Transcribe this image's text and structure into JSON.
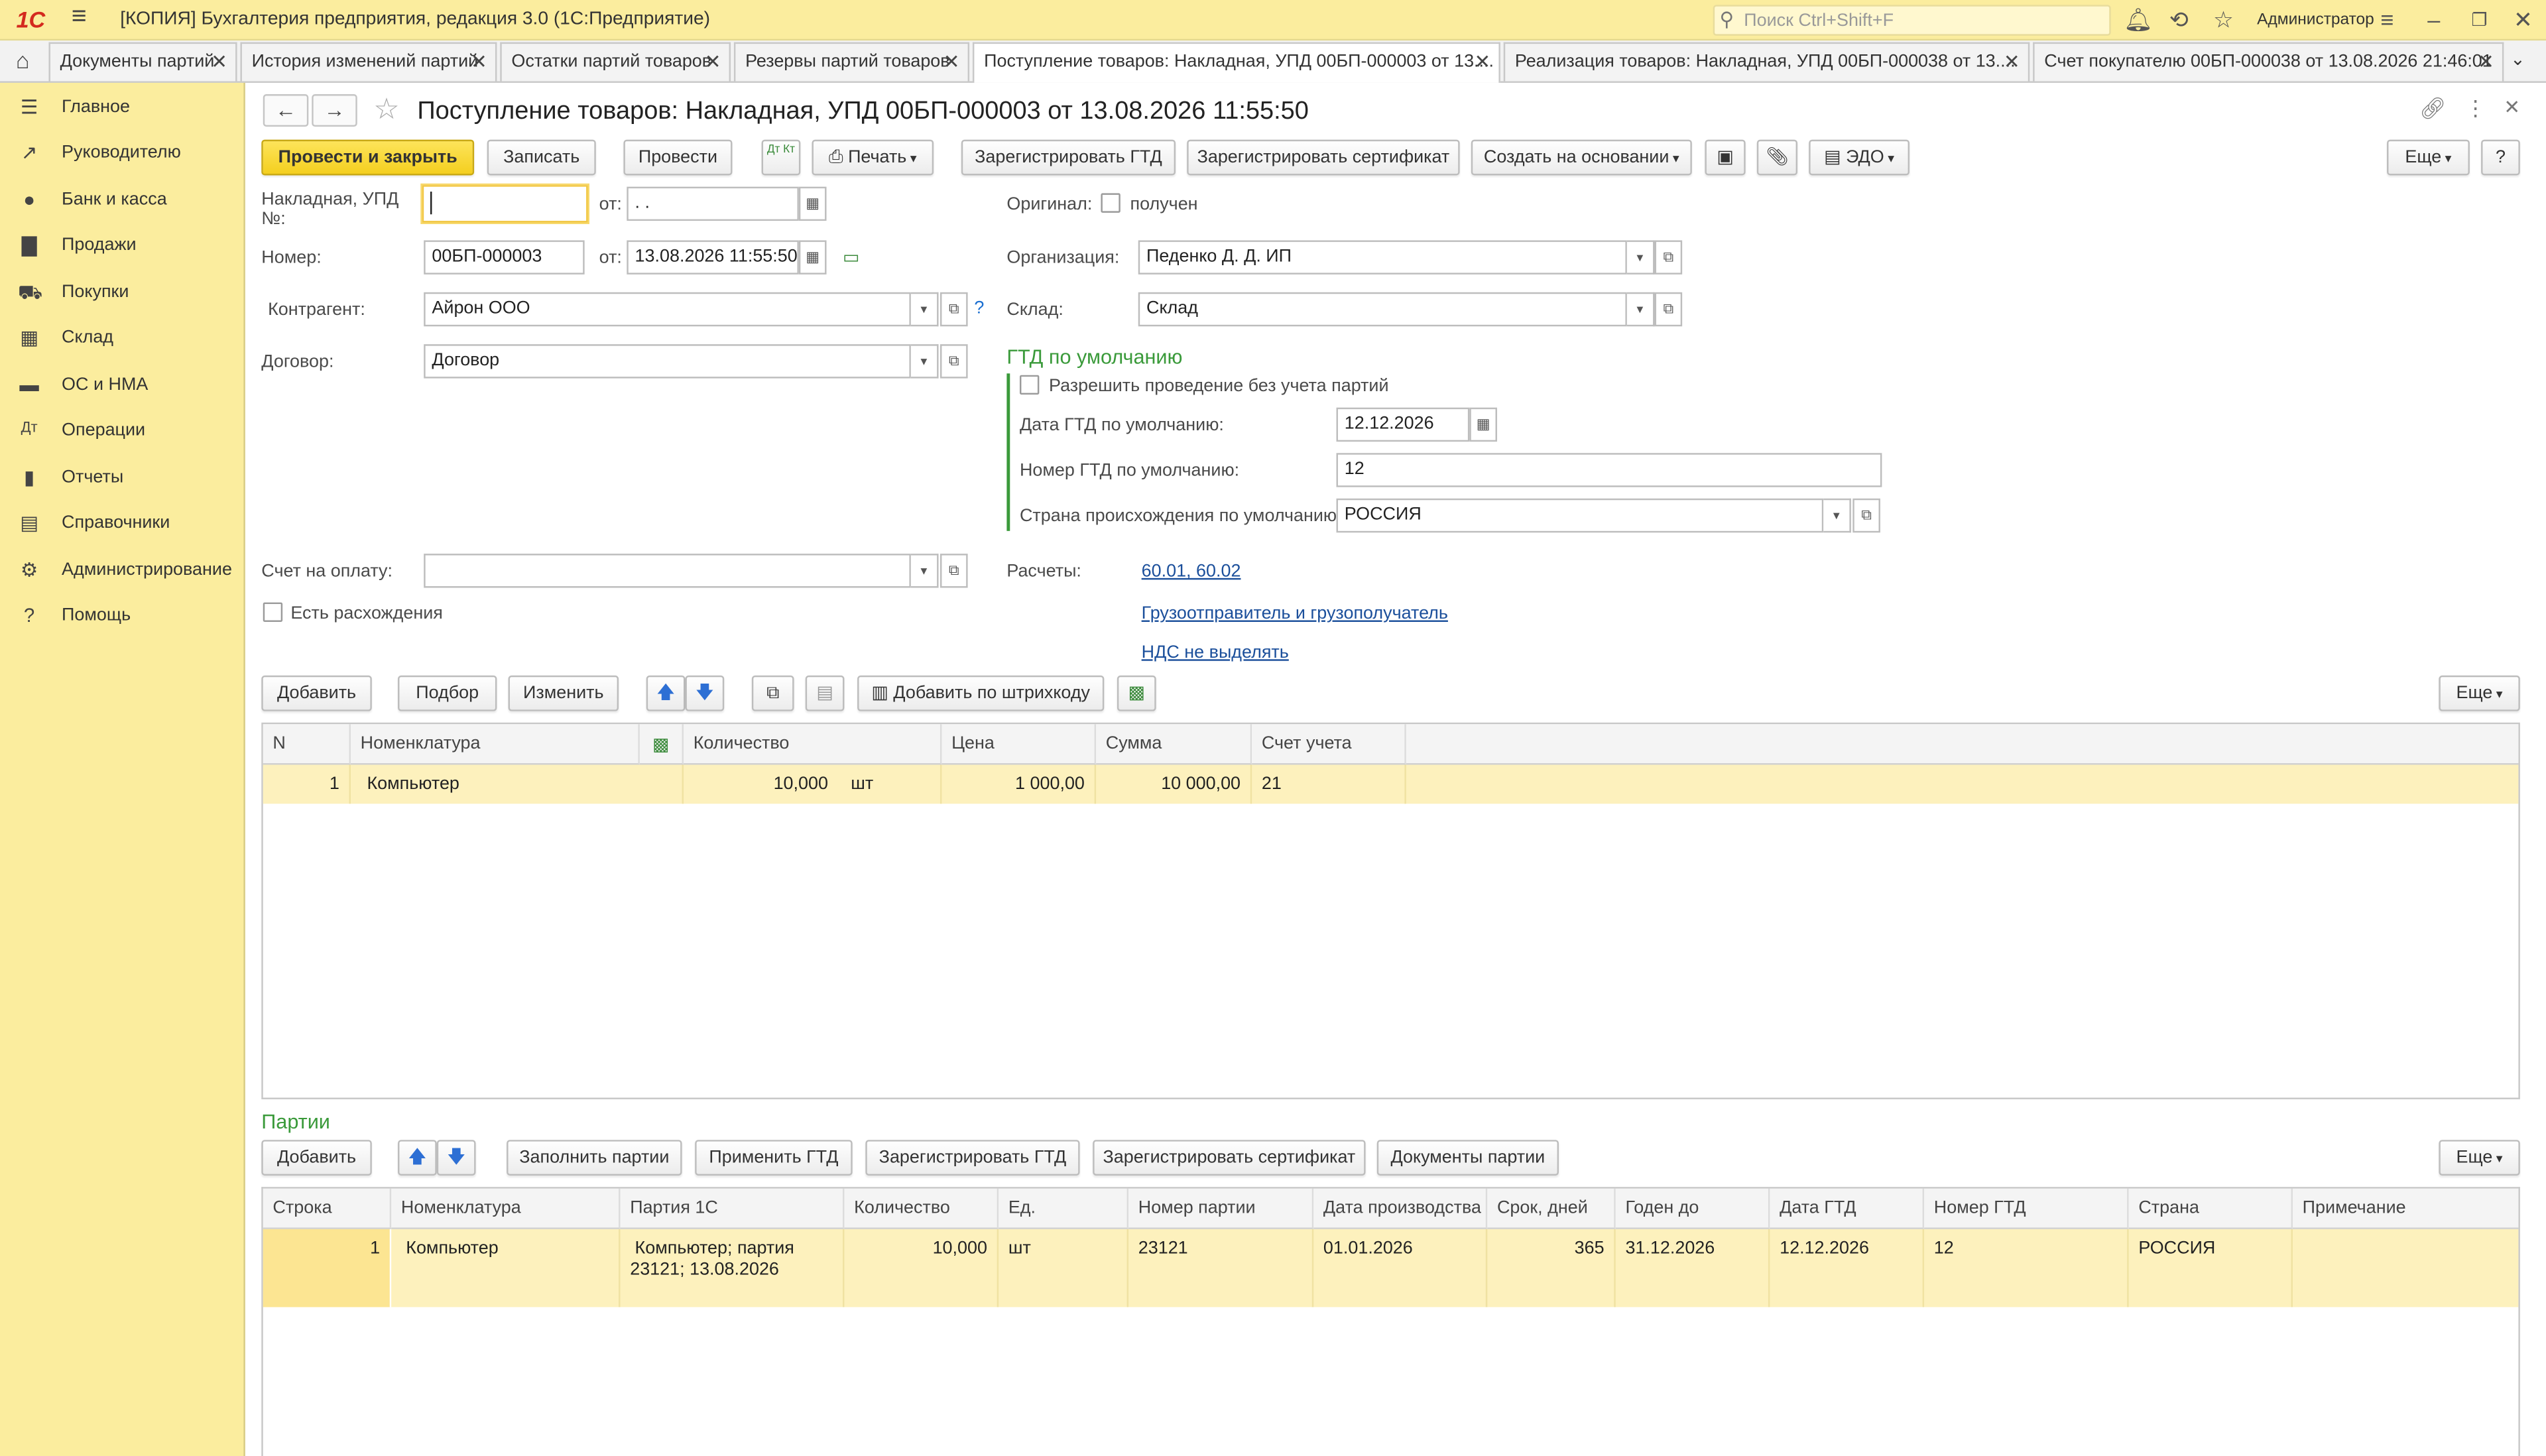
{
  "app": {
    "logo": "1С",
    "title": "[КОПИЯ] Бухгалтерия предприятия, редакция 3.0  (1С:Предприятие)",
    "search_placeholder": "Поиск Ctrl+Shift+F",
    "user": "Администратор"
  },
  "tabs": [
    "Документы партий",
    "История изменений партий",
    "Остатки партий товаров",
    "Резервы партий товаров",
    "Поступление товаров: Накладная, УПД 00БП-000003 от 13....",
    "Реализация товаров: Накладная, УПД 00БП-000038 от 13....",
    "Счет покупателю 00БП-000038 от 13.08.2026 21:46:01"
  ],
  "sidebar": [
    "Главное",
    "Руководителю",
    "Банк и касса",
    "Продажи",
    "Покупки",
    "Склад",
    "ОС и НМА",
    "Операции",
    "Отчеты",
    "Справочники",
    "Администрирование",
    "Помощь"
  ],
  "doc": {
    "title": "Поступление товаров: Накладная, УПД 00БП-000003 от 13.08.2026 11:55:50"
  },
  "toolbar": {
    "post_close": "Провести и закрыть",
    "save": "Записать",
    "post": "Провести",
    "dtkt": "Дт Кт",
    "print": "Печать",
    "reg_gtd": "Зарегистрировать ГТД",
    "reg_cert": "Зарегистрировать сертификат",
    "create_base": "Создать на основании",
    "edo": "ЭДО",
    "more": "Еще",
    "help": "?"
  },
  "form": {
    "invoice_label": "Накладная, УПД №:",
    "invoice_value": "",
    "from_label": "от:",
    "invoice_date": " .  .",
    "number_label": "Номер:",
    "number": "00БП-000003",
    "number_date": "13.08.2026 11:55:50",
    "contractor_label": "Контрагент:",
    "contractor": "Айрон ООО",
    "contract_label": "Договор:",
    "contract": "Договор",
    "payment_label": "Счет на оплату:",
    "payment": "",
    "discrepancy_label": "Есть расхождения",
    "original_label": "Оригинал:",
    "original_value": "получен",
    "org_label": "Организация:",
    "org": "Педенко Д. Д. ИП",
    "warehouse_label": "Склад:",
    "warehouse": "Склад",
    "gtd_header": "ГТД по умолчанию",
    "allow_label": "Разрешить проведение без учета партий",
    "gtd_date_label": "Дата ГТД по умолчанию:",
    "gtd_date": "12.12.2026",
    "gtd_num_label": "Номер ГТД по умолчанию:",
    "gtd_num": "12",
    "country_label": "Страна происхождения по умолчанию:",
    "country": "РОССИЯ",
    "settlements_label": "Расчеты:",
    "settlements": "60.01, 60.02",
    "shipper_link": "Грузоотправитель и грузополучатель",
    "vat_link": "НДС не выделять"
  },
  "goods_toolbar": {
    "add": "Добавить",
    "pick": "Подбор",
    "edit": "Изменить",
    "barcode": "Добавить по штрихкоду",
    "more": "Еще"
  },
  "goods_table": {
    "headers": [
      "N",
      "Номенклатура",
      "Количество",
      "Цена",
      "Сумма",
      "Счет учета"
    ],
    "row": {
      "n": "1",
      "item": "Компьютер",
      "qty": "10,000",
      "unit": "шт",
      "price": "1 000,00",
      "sum": "10 000,00",
      "account": "21"
    }
  },
  "batches": {
    "title": "Партии",
    "add": "Добавить",
    "fill": "Заполнить партии",
    "apply": "Применить ГТД",
    "reg_gtd": "Зарегистрировать ГТД",
    "reg_cert": "Зарегистрировать сертификат",
    "docs": "Документы партии",
    "more": "Еще",
    "headers": [
      "Строка",
      "Номенклатура",
      "Партия 1С",
      "Количество",
      "Ед.",
      "Номер партии",
      "Дата производства",
      "Срок, дней",
      "Годен до",
      "Дата ГТД",
      "Номер ГТД",
      "Страна",
      "Примечание"
    ],
    "row": {
      "line": "1",
      "item": "Компьютер",
      "batch1": "Компьютер; партия",
      "batch2": "23121; 13.08.2026",
      "qty": "10,000",
      "unit": "шт",
      "batch_no": "23121",
      "prod_date": "01.01.2026",
      "days": "365",
      "expiry": "31.12.2026",
      "gtd_date": "12.12.2026",
      "gtd_no": "12",
      "country": "РОССИЯ",
      "note": ""
    }
  }
}
